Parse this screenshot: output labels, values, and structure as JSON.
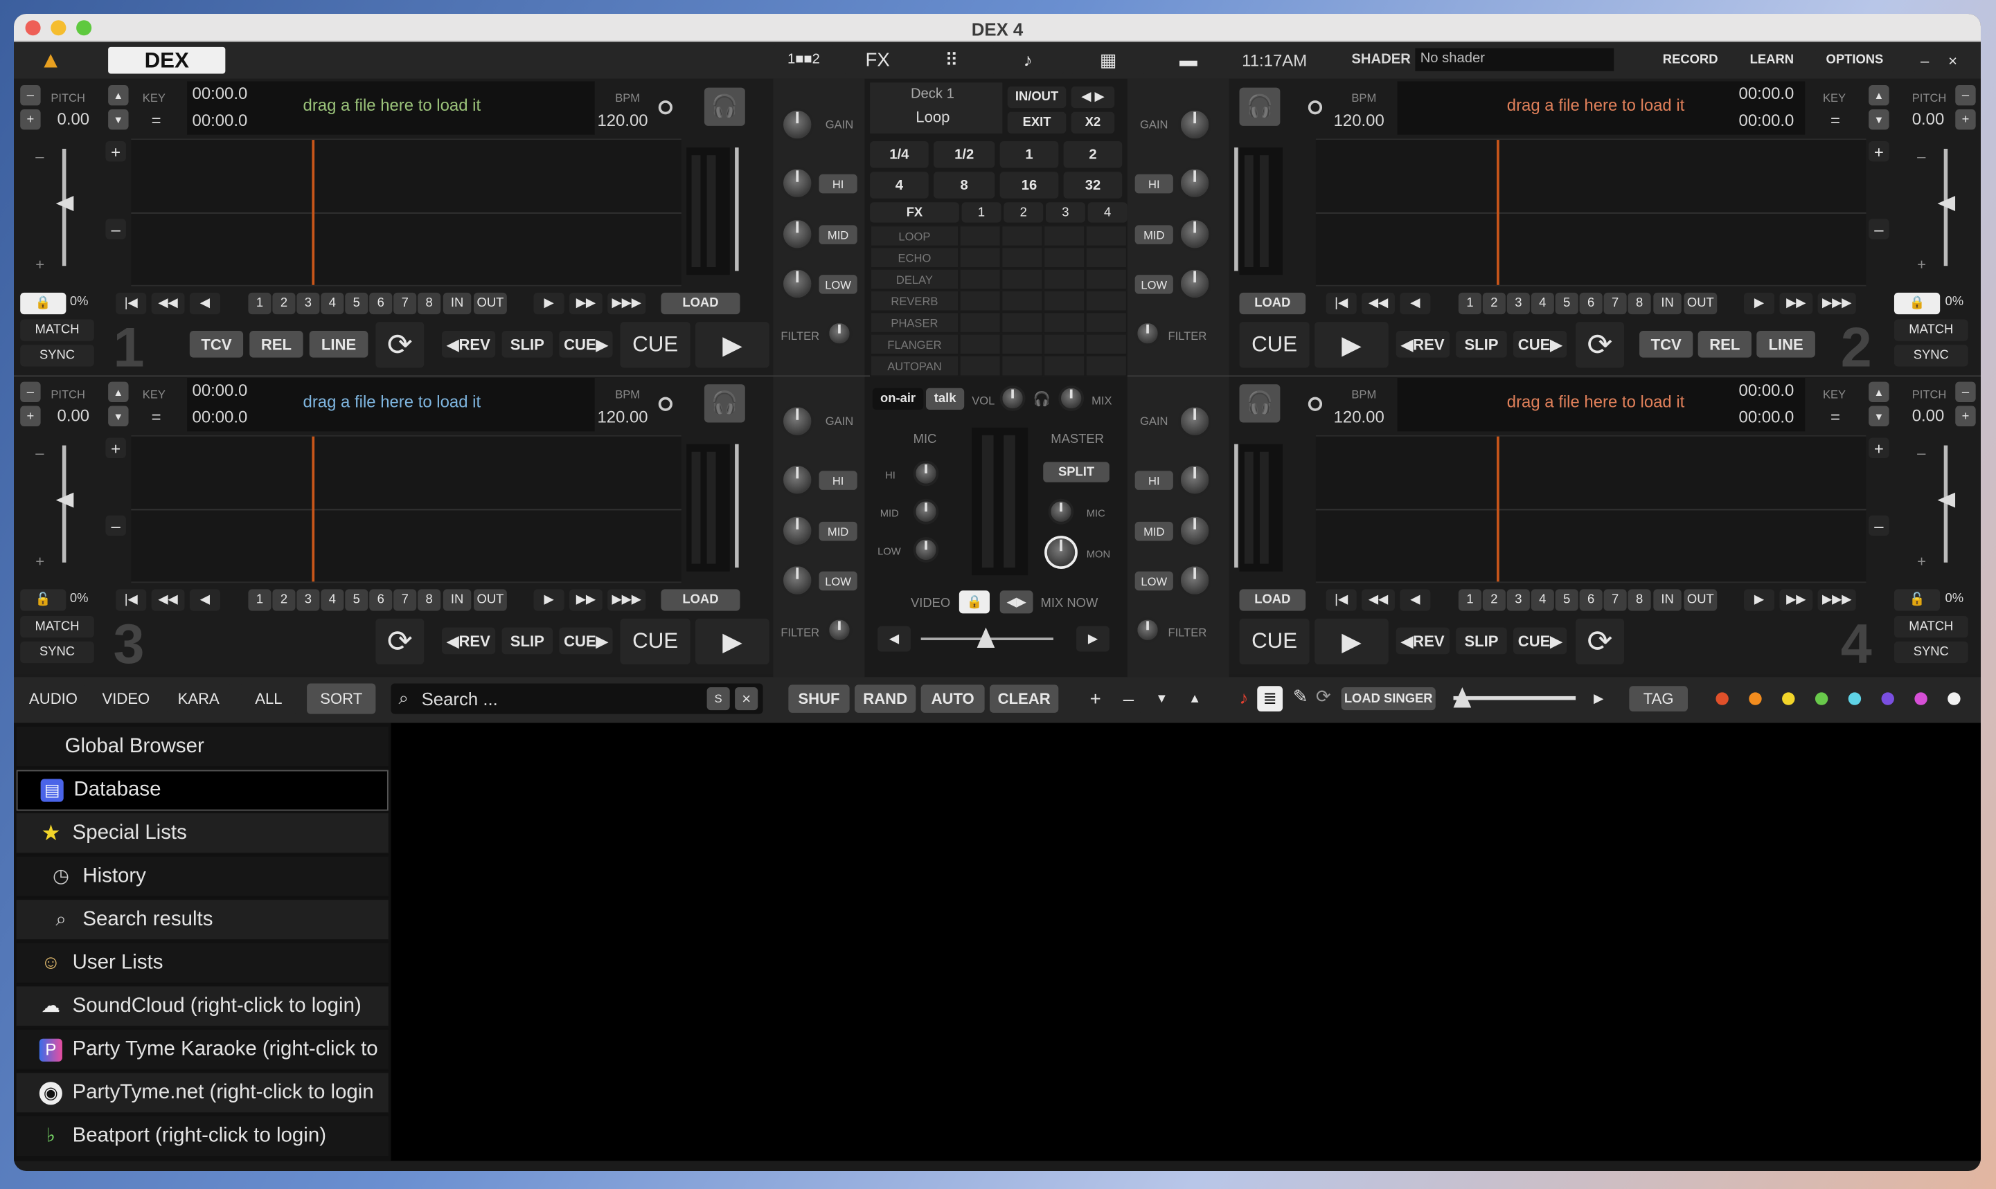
{
  "window": {
    "title": "DEX 4"
  },
  "topbar": {
    "logo": "DEX",
    "time": "11:17AM",
    "shader_label": "SHADER",
    "shader_value": "No shader",
    "record": "RECORD",
    "learn": "LEARN",
    "options": "OPTIONS",
    "minimize": "–",
    "close": "×",
    "fx": "FX",
    "layout": "1■■2"
  },
  "deck": {
    "pitch": "PITCH",
    "pitch_val": "0.00",
    "key": "KEY",
    "key_val": "=",
    "time1": "00:00.0",
    "time2": "00:00.0",
    "drag": "drag a file here to load it",
    "bpm": "BPM",
    "bpm_val": "120.00",
    "percent": "0%",
    "match": "MATCH",
    "sync": "SYNC",
    "load": "LOAD",
    "tcv": "TCV",
    "rel": "REL",
    "line": "LINE",
    "rev": "◀REV",
    "slip": "SLIP",
    "cue_fwd": "CUE▶",
    "cue": "CUE",
    "in": "IN",
    "out": "OUT",
    "plus": "+",
    "minus": "–",
    "n1": "1",
    "n2": "2",
    "n3": "3",
    "n4": "4",
    "n5": "5",
    "n6": "6",
    "n7": "7",
    "n8": "8",
    "deck_nums": [
      "1",
      "2",
      "3",
      "4"
    ]
  },
  "mixer": {
    "gain": "GAIN",
    "hi": "HI",
    "mid": "MID",
    "low": "LOW",
    "filter": "FILTER",
    "deck_label": "Deck 1",
    "loop_label": "Loop",
    "inout": "IN/OUT",
    "exit": "EXIT",
    "x2": "X2",
    "loop_sizes": [
      "1/4",
      "1/2",
      "1",
      "2",
      "4",
      "8",
      "16",
      "32"
    ],
    "fx": "FX",
    "fx_cols": [
      "1",
      "2",
      "3",
      "4"
    ],
    "fx_list": [
      "LOOP",
      "ECHO",
      "DELAY",
      "REVERB",
      "PHASER",
      "FLANGER",
      "AUTOPAN"
    ],
    "onair": "on-air",
    "talk": "talk",
    "vol": "VOL",
    "mix": "MIX",
    "mic": "MIC",
    "master": "MASTER",
    "split": "SPLIT",
    "mon": "MON",
    "video": "VIDEO",
    "mixnow": "MIX NOW"
  },
  "browser": {
    "tabs": [
      "AUDIO",
      "VIDEO",
      "KARA",
      "ALL",
      "SORT"
    ],
    "search_placeholder": "Search ...",
    "s": "S",
    "x": "×",
    "actions": [
      "SHUF",
      "RAND",
      "AUTO",
      "CLEAR"
    ],
    "load_singer": "LOAD SINGER",
    "tag": "TAG",
    "tag_colors": [
      "#e0502a",
      "#f28c1e",
      "#f2d52a",
      "#69c94b",
      "#5fd3e6",
      "#7a4fe0",
      "#d64fd6",
      "#f2f2f2"
    ],
    "tree": [
      {
        "label": "Global Browser",
        "icon": ""
      },
      {
        "label": "Database",
        "icon": "db"
      },
      {
        "label": "Special Lists",
        "icon": "star"
      },
      {
        "label": "History",
        "icon": "clock"
      },
      {
        "label": "Search results",
        "icon": "mag"
      },
      {
        "label": "User Lists",
        "icon": "user"
      },
      {
        "label": "SoundCloud (right-click to login)",
        "icon": "cloud"
      },
      {
        "label": "Party Tyme Karaoke (right-click to",
        "icon": "pt"
      },
      {
        "label": "PartyTyme.net (right-click to login",
        "icon": "mic"
      },
      {
        "label": "Beatport (right-click to login)",
        "icon": "bp"
      }
    ]
  }
}
